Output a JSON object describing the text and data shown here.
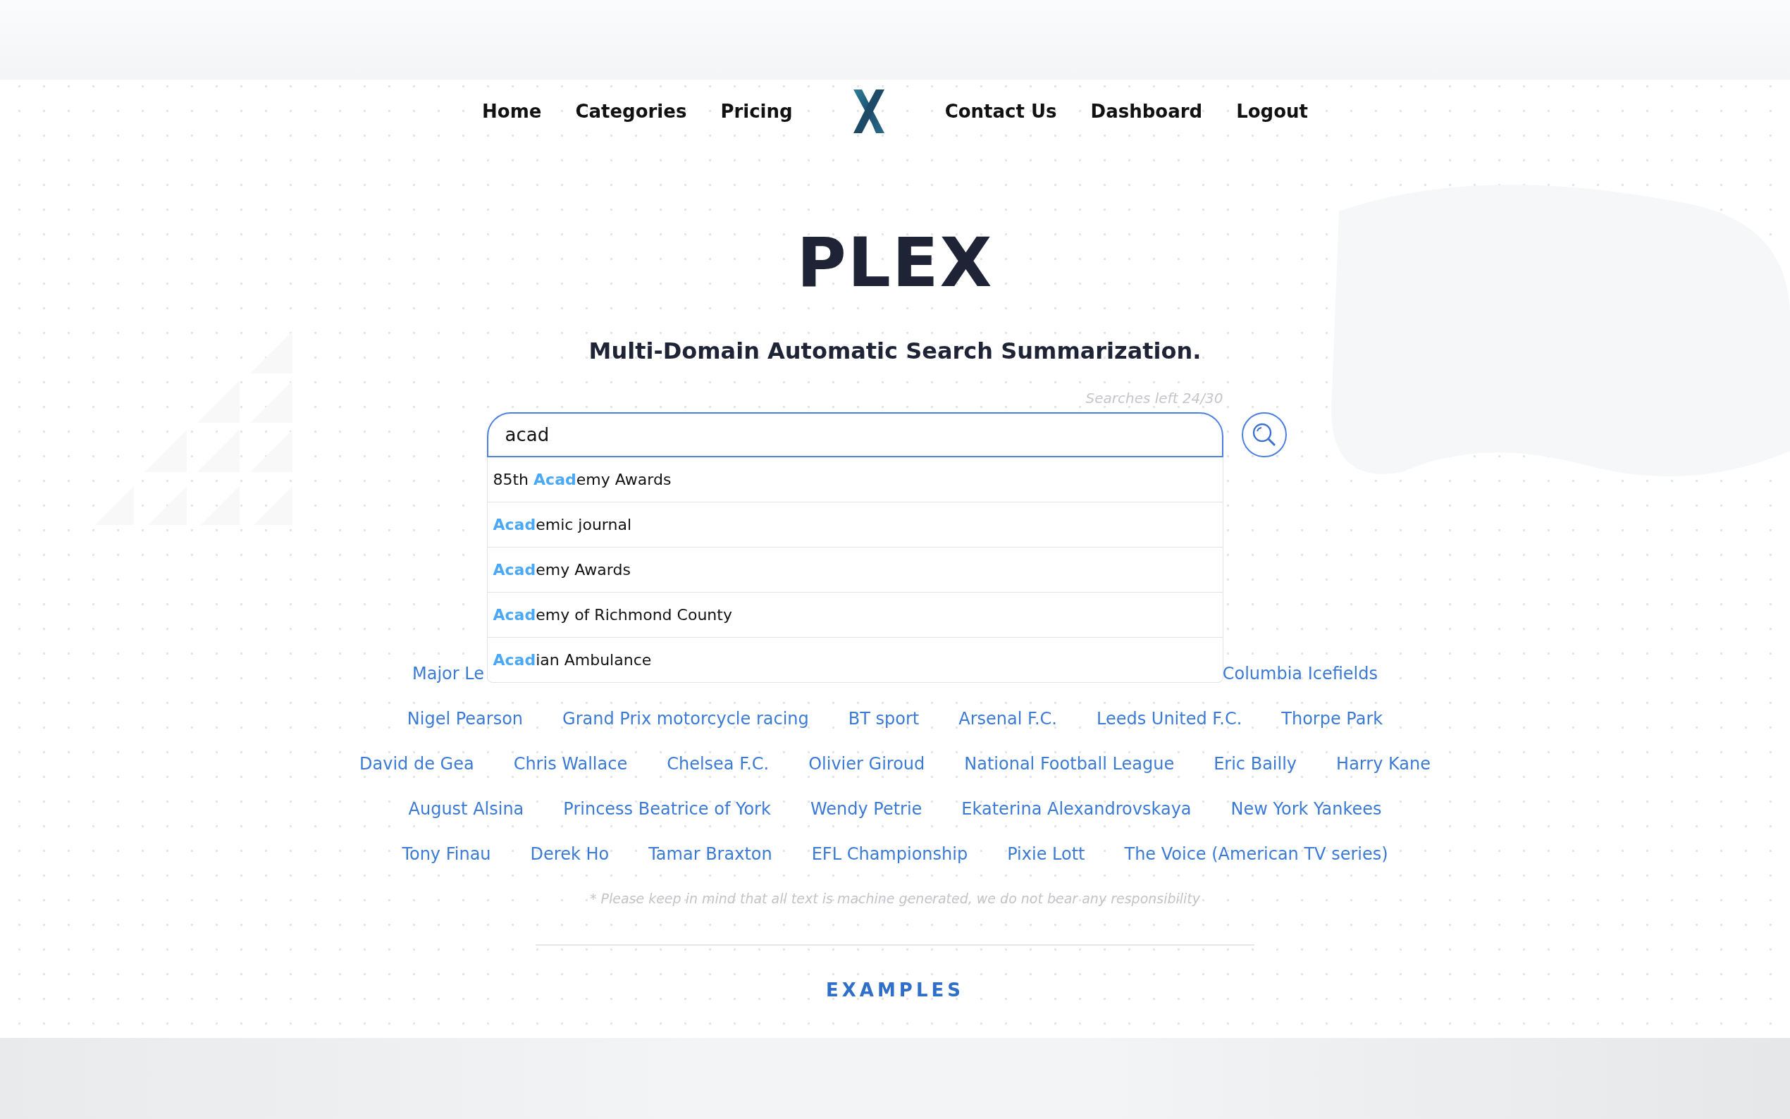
{
  "nav": {
    "left": [
      {
        "label": "Home"
      },
      {
        "label": "Categories"
      },
      {
        "label": "Pricing"
      }
    ],
    "right": [
      {
        "label": "Contact Us"
      },
      {
        "label": "Dashboard"
      },
      {
        "label": "Logout"
      }
    ]
  },
  "title": "PLEX",
  "subtitle": "Multi-Domain Automatic Search Summarization.",
  "search": {
    "counter": "Searches left 24/30",
    "value": "acad",
    "suggestions": [
      "85th **Acad**emy Awards",
      "**Acad**emic journal",
      "**Acad**emy Awards",
      "**Acad**emy of Richmond County",
      "**Acad**ian Ambulance"
    ]
  },
  "topics": [
    [
      "Major Le",
      "Columbia Icefields"
    ],
    [
      "Nigel Pearson",
      "Grand Prix motorcycle racing",
      "BT sport",
      "Arsenal F.C.",
      "Leeds United F.C.",
      "Thorpe Park"
    ],
    [
      "David de Gea",
      "Chris Wallace",
      "Chelsea F.C.",
      "Olivier Giroud",
      "National Football League",
      "Eric Bailly",
      "Harry Kane"
    ],
    [
      "August Alsina",
      "Princess Beatrice of York",
      "Wendy Petrie",
      "Ekaterina Alexandrovskaya",
      "New York Yankees"
    ],
    [
      "Tony Finau",
      "Derek Ho",
      "Tamar Braxton",
      "EFL Championship",
      "Pixie Lott",
      "The Voice (American TV series)"
    ]
  ],
  "disclaimer": "* Please keep in mind that all text is machine generated, we do not bear any responsibility",
  "section_heading": "EXAMPLES"
}
